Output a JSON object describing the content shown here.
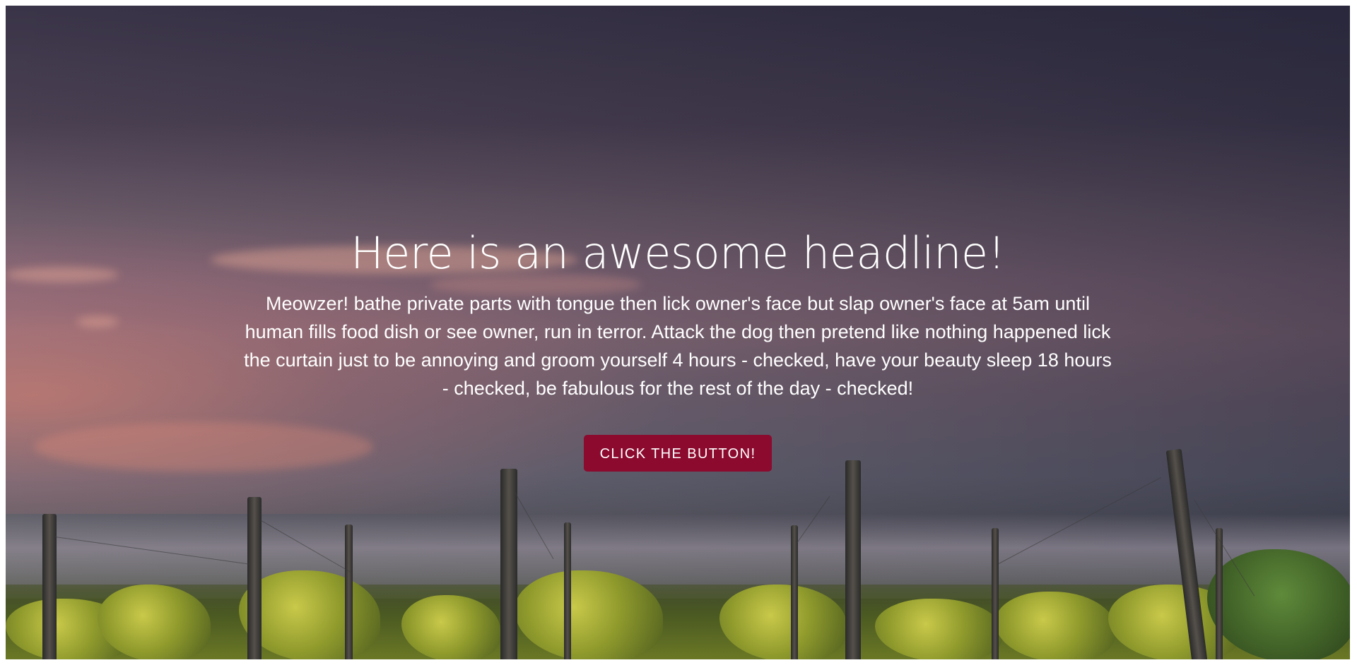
{
  "hero": {
    "headline": "Here is an awesome headline!",
    "body": "Meowzer! bathe private parts with tongue then lick owner's face but slap owner's face at 5am until human fills food dish or see owner, run in terror. Attack the dog then pretend like nothing happened lick the curtain just to be annoying and groom yourself 4 hours - checked, have your beauty sleep 18 hours - checked, be fabulous for the rest of the day - checked!",
    "button_label": "CLICK THE BUTTON!",
    "background_image": "vineyard-sunset-image"
  },
  "colors": {
    "button": "#8b0a2e",
    "text": "#ffffff"
  }
}
